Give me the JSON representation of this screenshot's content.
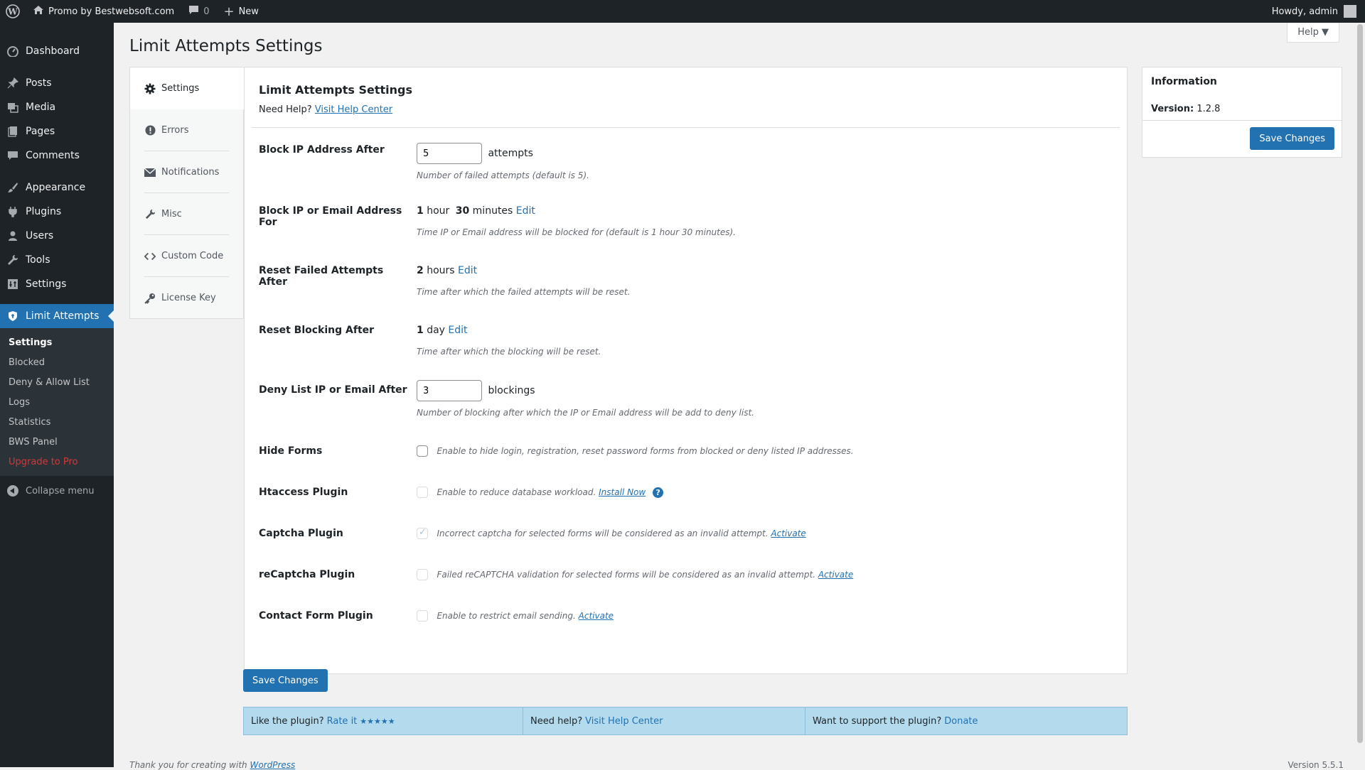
{
  "adminbar": {
    "site_name": "Promo by Bestwebsoft.com",
    "comments_count": "0",
    "new_label": "New",
    "howdy": "Howdy, admin"
  },
  "menu": {
    "dashboard": "Dashboard",
    "posts": "Posts",
    "media": "Media",
    "pages": "Pages",
    "comments": "Comments",
    "appearance": "Appearance",
    "plugins": "Plugins",
    "users": "Users",
    "tools": "Tools",
    "settings": "Settings",
    "limit_attempts": "Limit Attempts",
    "submenu": [
      "Settings",
      "Blocked",
      "Deny & Allow List",
      "Logs",
      "Statistics",
      "BWS Panel",
      "Upgrade to Pro"
    ],
    "collapse": "Collapse menu"
  },
  "help_tab": "Help ▼",
  "page_title": "Limit Attempts Settings",
  "tabs": [
    "Settings",
    "Errors",
    "Notifications",
    "Misc",
    "Custom Code",
    "License Key"
  ],
  "main": {
    "title": "Limit Attempts Settings",
    "need_help": "Need Help?",
    "visit_help_center": "Visit Help Center",
    "block_ip": {
      "label": "Block IP Address After",
      "value": "5",
      "unit": "attempts",
      "desc": "Number of failed attempts (default is 5)."
    },
    "block_for": {
      "label": "Block IP or Email Address For",
      "hours": "1",
      "hour_word": "hour",
      "minutes": "30",
      "minutes_word": "minutes",
      "edit": "Edit",
      "desc": "Time IP or Email address will be blocked for (default is 1 hour 30 minutes)."
    },
    "reset_failed": {
      "label": "Reset Failed Attempts After",
      "hours": "2",
      "hours_word": "hours",
      "edit": "Edit",
      "desc": "Time after which the failed attempts will be reset."
    },
    "reset_blocking": {
      "label": "Reset Blocking After",
      "days": "1",
      "day_word": "day",
      "edit": "Edit",
      "desc": "Time after which the blocking will be reset."
    },
    "deny_list": {
      "label": "Deny List IP or Email After",
      "value": "3",
      "unit": "blockings",
      "desc": "Number of blocking after which the IP or Email address will be add to deny list."
    },
    "hide_forms": {
      "label": "Hide Forms",
      "desc": "Enable to hide login, registration, reset password forms from blocked or deny listed IP addresses."
    },
    "htaccess": {
      "label": "Htaccess Plugin",
      "desc": "Enable to reduce database workload.",
      "link": "Install Now",
      "help": "?"
    },
    "captcha": {
      "label": "Captcha Plugin",
      "desc": "Incorrect captcha for selected forms will be considered as an invalid attempt.",
      "link": "Activate"
    },
    "recaptcha": {
      "label": "reCaptcha Plugin",
      "desc": "Failed reCAPTCHA validation for selected forms will be considered as an invalid attempt.",
      "link": "Activate"
    },
    "contact_form": {
      "label": "Contact Form Plugin",
      "desc": "Enable to restrict email sending.",
      "link": "Activate"
    }
  },
  "save_changes": "Save Changes",
  "info": {
    "title": "Information",
    "version_label": "Version:",
    "version": "1.2.8",
    "save": "Save Changes"
  },
  "footer_bar": {
    "like": "Like the plugin?",
    "rate": "Rate it",
    "stars": "★★★★★",
    "need_help": "Need help?",
    "help_center": "Visit Help Center",
    "support": "Want to support the plugin?",
    "donate": "Donate"
  },
  "footer": {
    "thanks": "Thank you for creating with",
    "wordpress": "WordPress",
    "version": "Version 5.5.1"
  }
}
